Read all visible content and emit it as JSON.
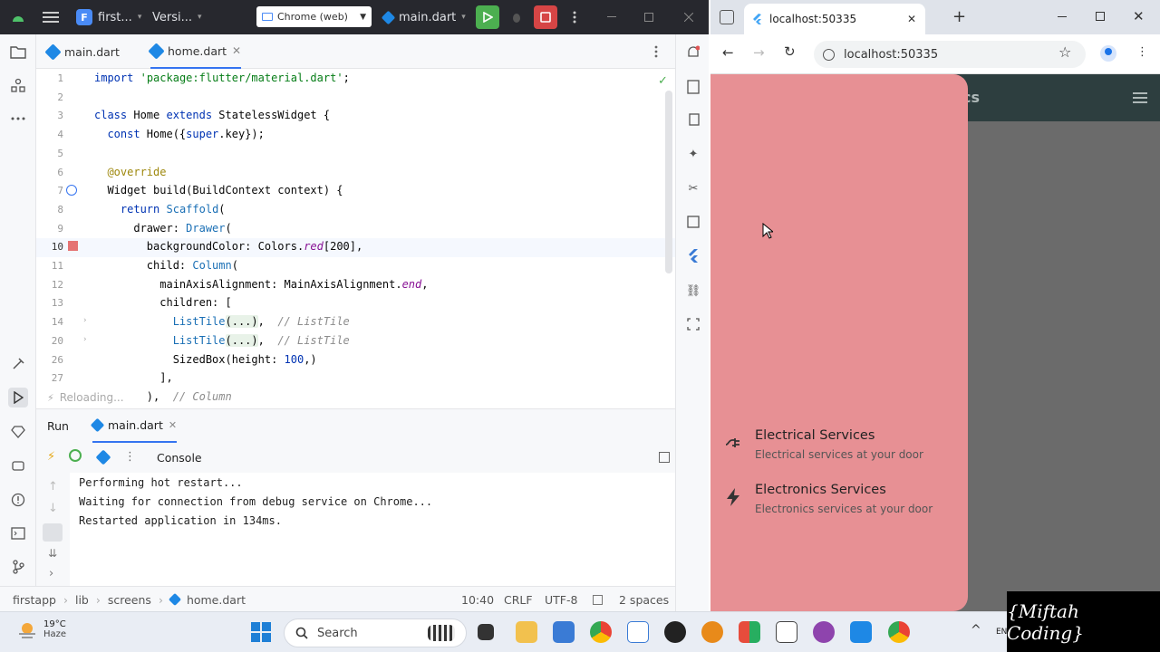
{
  "ide": {
    "project_badge": "F",
    "project_name": "first...",
    "vcs_label": "Versi...",
    "device": "Chrome (web)",
    "run_config": "main.dart",
    "tabs": [
      {
        "label": "main.dart"
      },
      {
        "label": "home.dart"
      }
    ],
    "editor": {
      "lines": [
        {
          "n": "1",
          "html": "<span class='kw'>import</span> <span class='str'>'package:flutter/material.dart'</span>;"
        },
        {
          "n": "2",
          "html": ""
        },
        {
          "n": "3",
          "html": "<span class='kw'>class</span> Home <span class='kw'>extends</span> StatelessWidget {"
        },
        {
          "n": "4",
          "html": "  <span class='kw'>const</span> Home({<span class='kw'>super</span>.key});"
        },
        {
          "n": "5",
          "html": ""
        },
        {
          "n": "6",
          "html": "  <span class='ann'>@override</span>"
        },
        {
          "n": "7",
          "html": "  Widget build(BuildContext context) {"
        },
        {
          "n": "8",
          "html": "    <span class='kw'>return</span> <span class='cls'>Scaffold</span>("
        },
        {
          "n": "9",
          "html": "      drawer: <span class='cls'>Drawer</span>("
        },
        {
          "n": "10",
          "html": "        backgroundColor: Colors.<span class='it'>red</span>[200],"
        },
        {
          "n": "11",
          "html": "        child: <span class='cls'>Column</span>("
        },
        {
          "n": "12",
          "html": "          mainAxisAlignment: MainAxisAlignment.<span class='it'>end</span>,"
        },
        {
          "n": "13",
          "html": "          children: ["
        },
        {
          "n": "14",
          "html": "            <span class='cls'>ListTile</span><span class='fold'>(...)</span>,  <span class='cm'>// ListTile</span>"
        },
        {
          "n": "20",
          "html": "            <span class='cls'>ListTile</span><span class='fold'>(...)</span>,  <span class='cm'>// ListTile</span>"
        },
        {
          "n": "26",
          "html": "            SizedBox(height: <span class='kw'>100</span>,)"
        },
        {
          "n": "27",
          "html": "          ],"
        },
        {
          "n": "",
          "html": "        ),  <span class='cm'>// Column</span>"
        }
      ]
    },
    "reloading_label": "Reloading...",
    "run": {
      "title": "Run",
      "tab": "main.dart",
      "console_label": "Console",
      "console_lines": [
        "Performing hot restart...",
        "Waiting for connection from debug service on Chrome...",
        "Restarted application in 134ms."
      ]
    },
    "status": {
      "breadcrumb": [
        "firstapp",
        "lib",
        "screens",
        "home.dart"
      ],
      "position": "10:40",
      "line_sep": "CRLF",
      "encoding": "UTF-8",
      "indent": "2 spaces"
    }
  },
  "browser": {
    "tab_title": "localhost:50335",
    "url": "localhost:50335",
    "app": {
      "appbar_title_fragment": "cs",
      "drawer_color": "#e79094",
      "tiles": [
        {
          "title": "Electrical Services",
          "subtitle": "Electrical services at your door",
          "icon": "power-plug-icon"
        },
        {
          "title": "Electronics Services",
          "subtitle": "Electronics services at your door",
          "icon": "flash-icon"
        }
      ]
    }
  },
  "taskbar": {
    "temperature": "19°C",
    "condition": "Haze",
    "search_placeholder": "Search",
    "lang": "EN"
  },
  "watermark": "{Miftah Coding}"
}
